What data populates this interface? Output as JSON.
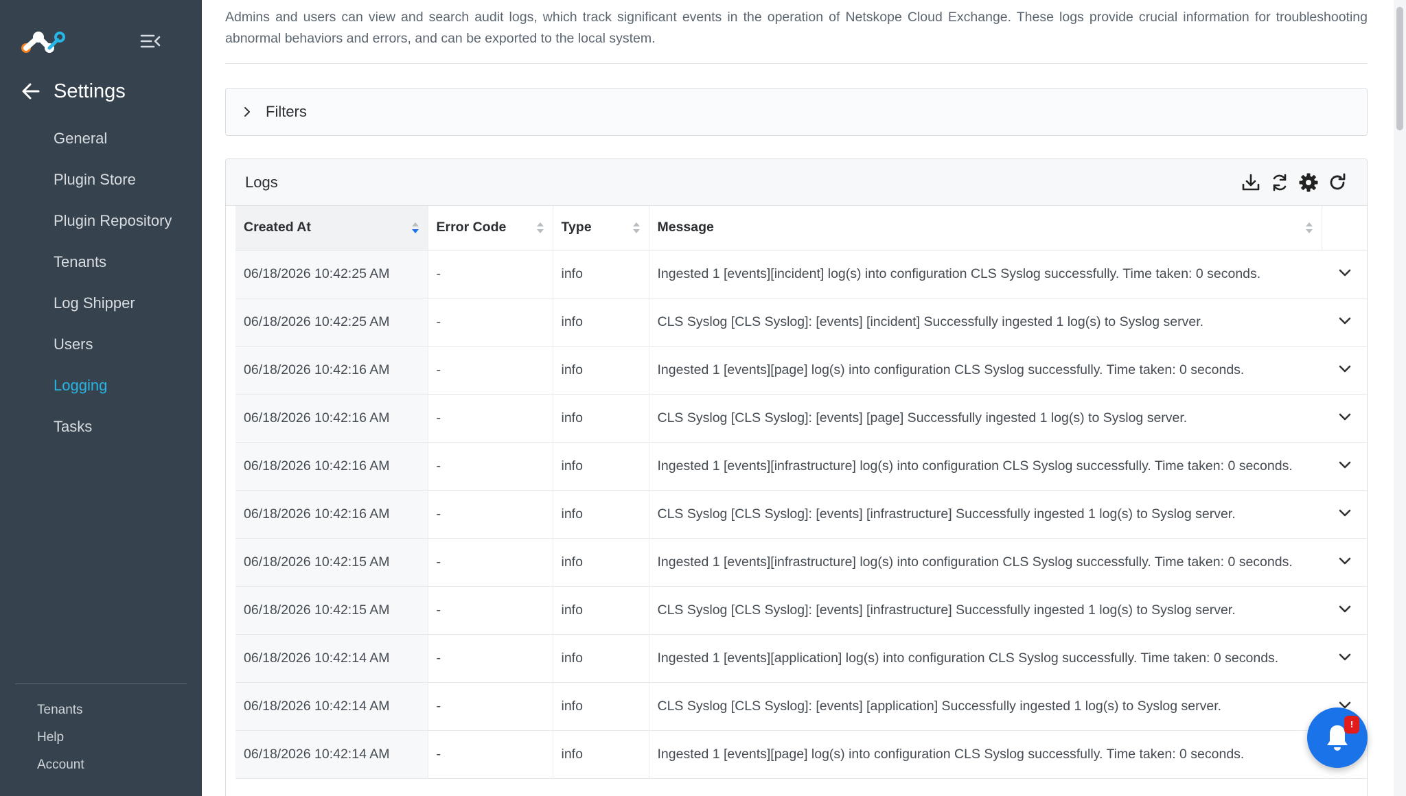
{
  "colors": {
    "sidebar_bg": "#36424d",
    "accent": "#27b5e6",
    "fab": "#1a73e8",
    "badge": "#e21b1b"
  },
  "sidebar": {
    "back_icon": "arrow-left-icon",
    "collapse_icon": "collapse-menu-icon",
    "title": "Settings",
    "items": [
      {
        "label": "General"
      },
      {
        "label": "Plugin Store"
      },
      {
        "label": "Plugin Repository"
      },
      {
        "label": "Tenants"
      },
      {
        "label": "Log Shipper"
      },
      {
        "label": "Users"
      },
      {
        "label": "Logging",
        "active": true
      },
      {
        "label": "Tasks"
      }
    ],
    "footer": [
      {
        "label": "Tenants"
      },
      {
        "label": "Help"
      },
      {
        "label": "Account"
      }
    ]
  },
  "description": "Admins and users can view and search audit logs, which track significant events in the operation of Netskope Cloud Exchange. These logs provide crucial information for troubleshooting abnormal behaviors and errors, and can be exported to the local system.",
  "filters": {
    "label": "Filters",
    "icon": "chevron-right-icon"
  },
  "logs": {
    "title": "Logs",
    "tools": [
      "download-icon",
      "sync-icon",
      "gear-icon",
      "refresh-icon"
    ],
    "columns": [
      "Created At",
      "Error Code",
      "Type",
      "Message"
    ],
    "rows": [
      {
        "created_at": "06/18/2026 10:42:25 AM",
        "error_code": "-",
        "type": "info",
        "message": "Ingested 1 [events][incident] log(s) into configuration CLS Syslog successfully. Time taken: 0 seconds."
      },
      {
        "created_at": "06/18/2026 10:42:25 AM",
        "error_code": "-",
        "type": "info",
        "message": "CLS Syslog [CLS Syslog]: [events] [incident] Successfully ingested 1 log(s) to Syslog server."
      },
      {
        "created_at": "06/18/2026 10:42:16 AM",
        "error_code": "-",
        "type": "info",
        "message": "Ingested 1 [events][page] log(s) into configuration CLS Syslog successfully. Time taken: 0 seconds."
      },
      {
        "created_at": "06/18/2026 10:42:16 AM",
        "error_code": "-",
        "type": "info",
        "message": "CLS Syslog [CLS Syslog]: [events] [page] Successfully ingested 1 log(s) to Syslog server."
      },
      {
        "created_at": "06/18/2026 10:42:16 AM",
        "error_code": "-",
        "type": "info",
        "message": "Ingested 1 [events][infrastructure] log(s) into configuration CLS Syslog successfully. Time taken: 0 seconds."
      },
      {
        "created_at": "06/18/2026 10:42:16 AM",
        "error_code": "-",
        "type": "info",
        "message": "CLS Syslog [CLS Syslog]: [events] [infrastructure] Successfully ingested 1 log(s) to Syslog server."
      },
      {
        "created_at": "06/18/2026 10:42:15 AM",
        "error_code": "-",
        "type": "info",
        "message": "Ingested 1 [events][infrastructure] log(s) into configuration CLS Syslog successfully. Time taken: 0 seconds."
      },
      {
        "created_at": "06/18/2026 10:42:15 AM",
        "error_code": "-",
        "type": "info",
        "message": "CLS Syslog [CLS Syslog]: [events] [infrastructure] Successfully ingested 1 log(s) to Syslog server."
      },
      {
        "created_at": "06/18/2026 10:42:14 AM",
        "error_code": "-",
        "type": "info",
        "message": "Ingested 1 [events][application] log(s) into configuration CLS Syslog successfully. Time taken: 0 seconds."
      },
      {
        "created_at": "06/18/2026 10:42:14 AM",
        "error_code": "-",
        "type": "info",
        "message": "CLS Syslog [CLS Syslog]: [events] [application] Successfully ingested 1 log(s) to Syslog server."
      },
      {
        "created_at": "06/18/2026 10:42:14 AM",
        "error_code": "-",
        "type": "info",
        "message": "Ingested 1 [events][page] log(s) into configuration CLS Syslog successfully. Time taken: 0 seconds."
      }
    ]
  },
  "notification": {
    "badge": "!",
    "icon": "bell-icon"
  }
}
